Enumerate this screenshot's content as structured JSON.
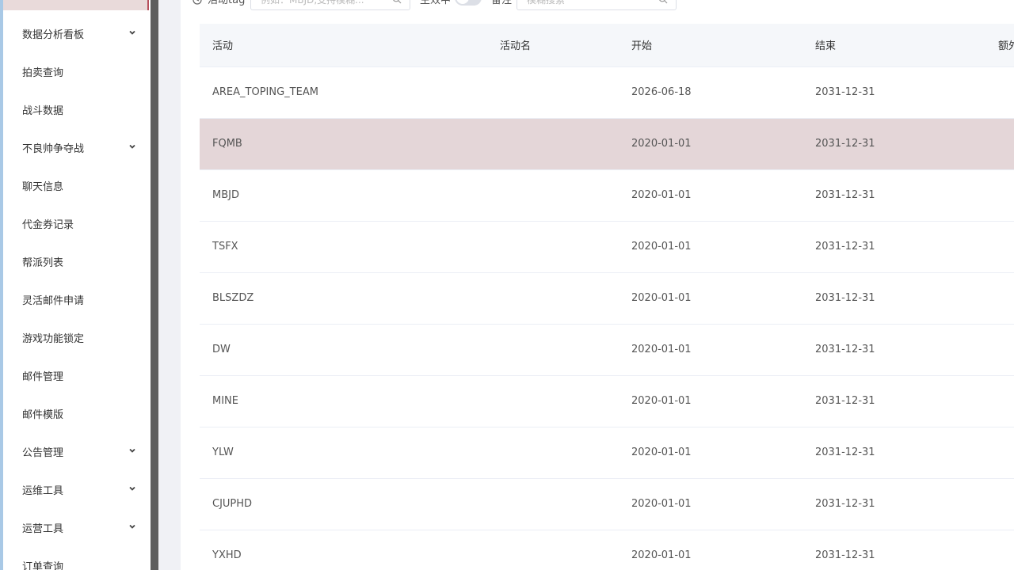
{
  "sidebar": {
    "items": [
      {
        "label": "数据分析看板",
        "expandable": true
      },
      {
        "label": "拍卖查询",
        "expandable": false
      },
      {
        "label": "战斗数据",
        "expandable": false
      },
      {
        "label": "不良帅争夺战",
        "expandable": true
      },
      {
        "label": "聊天信息",
        "expandable": false
      },
      {
        "label": "代金券记录",
        "expandable": false
      },
      {
        "label": "帮派列表",
        "expandable": false
      },
      {
        "label": "灵活邮件申请",
        "expandable": false
      },
      {
        "label": "游戏功能锁定",
        "expandable": false
      },
      {
        "label": "邮件管理",
        "expandable": false
      },
      {
        "label": "邮件模版",
        "expandable": false
      },
      {
        "label": "公告管理",
        "expandable": true
      },
      {
        "label": "运维工具",
        "expandable": true
      },
      {
        "label": "运营工具",
        "expandable": true
      },
      {
        "label": "订单查询",
        "expandable": false
      }
    ]
  },
  "filters": {
    "tag_label": "活动tag",
    "tag_placeholder": "例如：MBJD,支持模糊...",
    "active_label": "生效中",
    "remark_label": "备注",
    "remark_placeholder": "模糊搜索"
  },
  "table": {
    "columns": [
      "活动",
      "活动名",
      "开始",
      "结束",
      "额外"
    ],
    "rows": [
      {
        "activity": "AREA_TOPING_TEAM",
        "name": "",
        "start": "2026-06-18",
        "end": "2031-12-31",
        "extra": ""
      },
      {
        "activity": "FQMB",
        "name": "",
        "start": "2020-01-01",
        "end": "2031-12-31",
        "extra": ""
      },
      {
        "activity": "MBJD",
        "name": "",
        "start": "2020-01-01",
        "end": "2031-12-31",
        "extra": ""
      },
      {
        "activity": "TSFX",
        "name": "",
        "start": "2020-01-01",
        "end": "2031-12-31",
        "extra": ""
      },
      {
        "activity": "BLSZDZ",
        "name": "",
        "start": "2020-01-01",
        "end": "2031-12-31",
        "extra": ""
      },
      {
        "activity": "DW",
        "name": "",
        "start": "2020-01-01",
        "end": "2031-12-31",
        "extra": ""
      },
      {
        "activity": "MINE",
        "name": "",
        "start": "2020-01-01",
        "end": "2031-12-31",
        "extra": ""
      },
      {
        "activity": "YLW",
        "name": "",
        "start": "2020-01-01",
        "end": "2031-12-31",
        "extra": ""
      },
      {
        "activity": "CJUPHD",
        "name": "",
        "start": "2020-01-01",
        "end": "2031-12-31",
        "extra": ""
      },
      {
        "activity": "YXHD",
        "name": "",
        "start": "2020-01-01",
        "end": "2031-12-31",
        "extra": ""
      }
    ],
    "selected_row": 1
  },
  "colors": {
    "selected_row": "#e4d6d8",
    "active_accent": "#b7505c",
    "header_bg": "#f5f7fa"
  }
}
